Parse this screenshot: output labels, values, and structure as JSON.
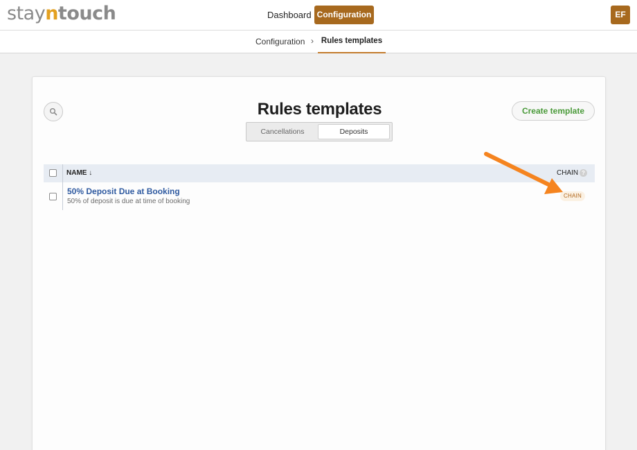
{
  "header": {
    "logo": {
      "part1": "stay",
      "part2": "n",
      "part3": "touch"
    },
    "nav": {
      "dashboard": "Dashboard",
      "configuration": "Configuration"
    },
    "avatar_initials": "EF",
    "accent_color": "#a7691e"
  },
  "breadcrumb": {
    "parent": "Configuration",
    "separator": "›",
    "current": "Rules templates"
  },
  "page": {
    "title": "Rules templates",
    "create_button": "Create template",
    "tabs": [
      {
        "label": "Cancellations",
        "active": false
      },
      {
        "label": "Deposits",
        "active": true
      }
    ]
  },
  "table": {
    "columns": {
      "name": "NAME ↓",
      "chain": "CHAIN",
      "chain_help": "?"
    },
    "rows": [
      {
        "name": "50% Deposit Due at Booking",
        "description": "50% of deposit is due at time of booking",
        "chain_badge": "CHAIN"
      }
    ]
  },
  "icons": {
    "search": "search-icon",
    "help": "help-icon",
    "arrow": "annotation-arrow-icon"
  },
  "colors": {
    "link": "#2f5aa0",
    "create": "#4a9a3a",
    "annotation_arrow": "#f5841f"
  }
}
